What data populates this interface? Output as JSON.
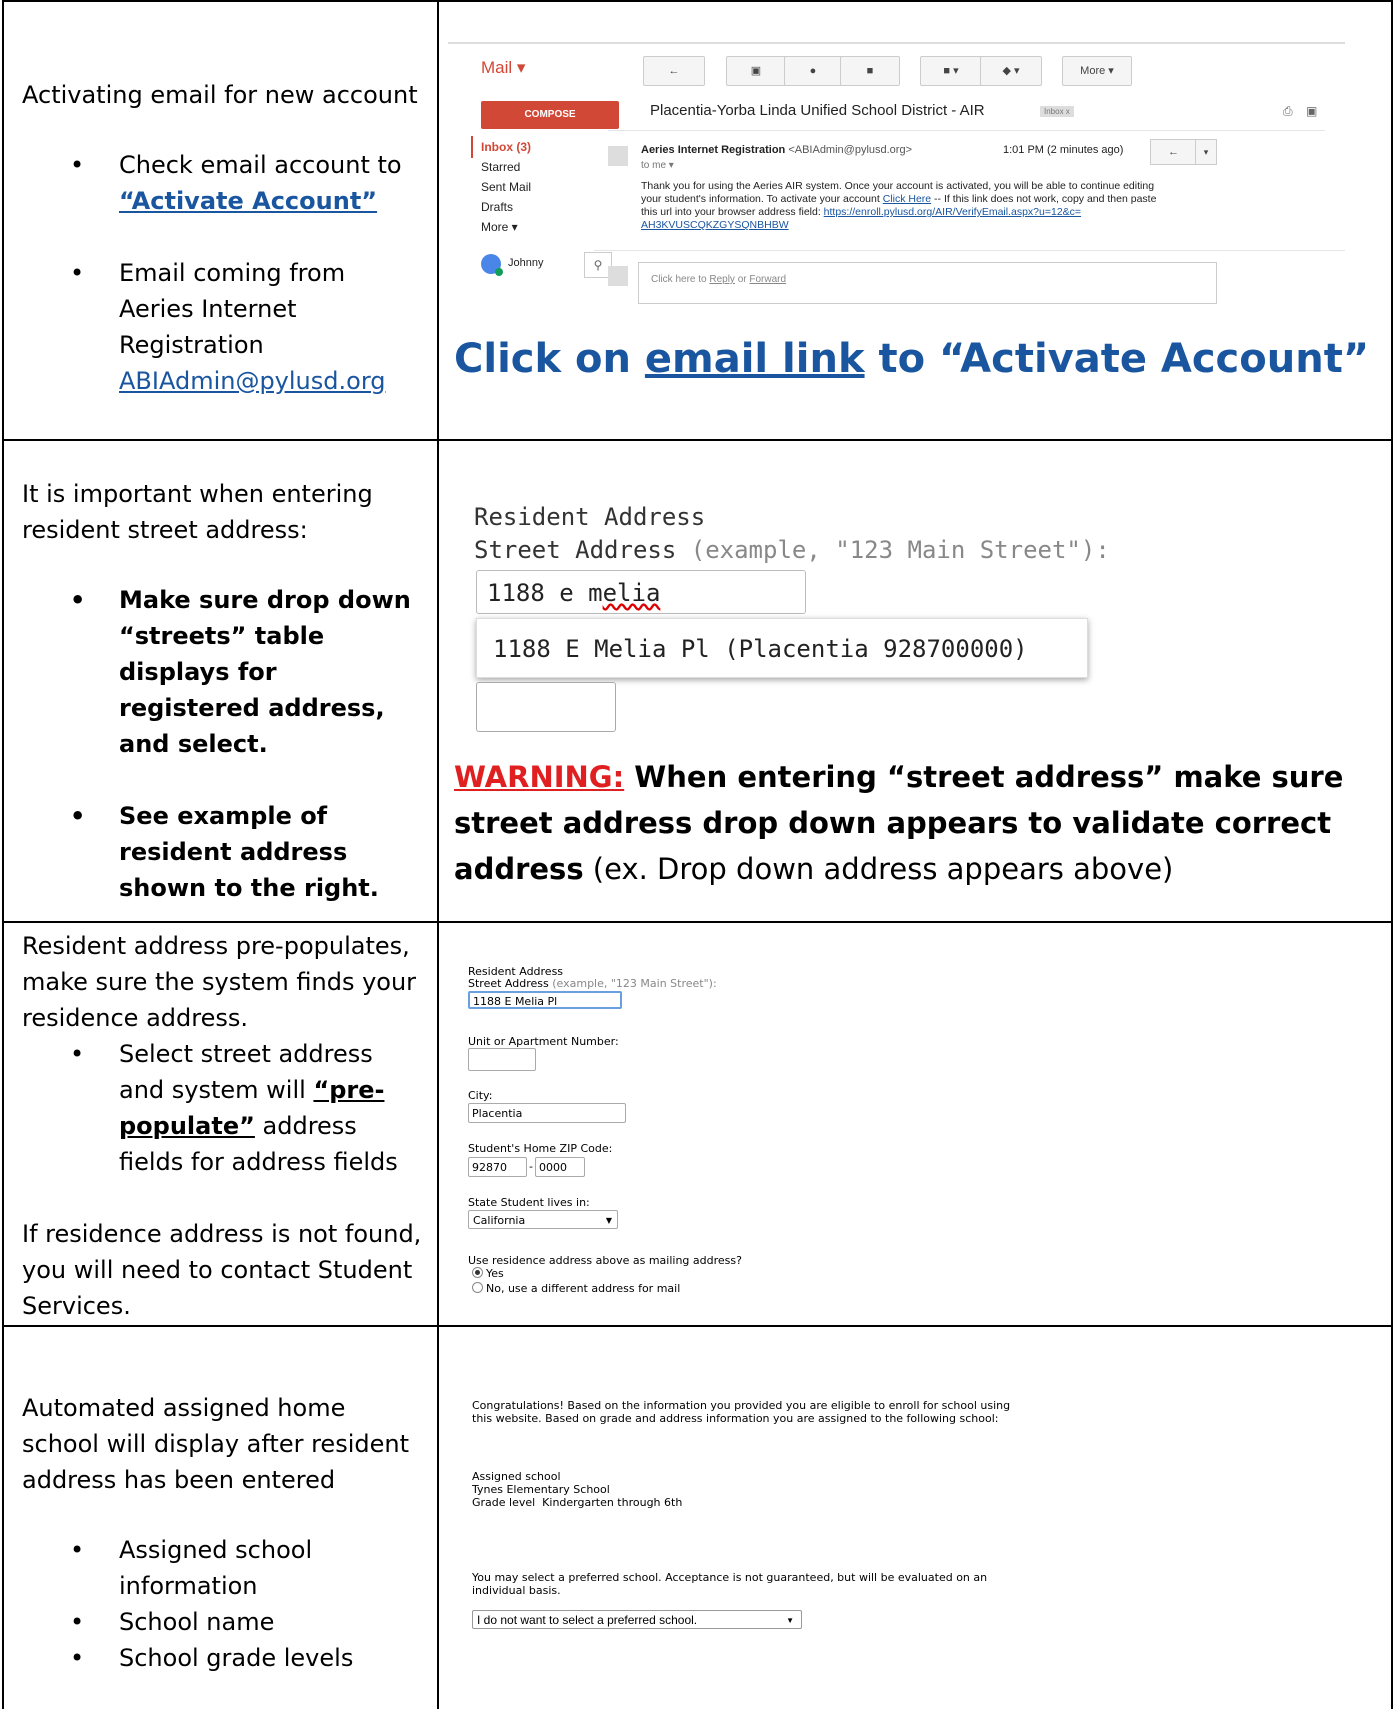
{
  "row1": {
    "left": {
      "heading": "Activating email for new account",
      "bullet1_text": "Check email account to",
      "bullet1_link": "“Activate Account”",
      "bullet2_text": "Email coming from Aeries Internet Registration",
      "bullet2_email": "ABIAdmin@pylusd.org"
    },
    "gmail": {
      "mail_label": "Mail ▾",
      "compose_label": "COMPOSE",
      "toolbar": [
        "←",
        "▣",
        "●",
        "■",
        "■ ▾",
        "◆ ▾",
        "More ▾"
      ],
      "subject": "Placentia-Yorba Linda Unified School District - AIR",
      "inbox_tag": "Inbox  x",
      "nav": [
        "Inbox (3)",
        "Starred",
        "Sent Mail",
        "Drafts",
        "More ▾"
      ],
      "user": "Johnny",
      "sender_name": "Aeries Internet Registration",
      "sender_email": "<ABIAdmin@pylusd.org>",
      "to_me": "to me ▾",
      "time": "1:01 PM (2 minutes ago)",
      "body_1": "Thank you for using the Aeries AIR system. Once your account is activated, you will be able to continue editing",
      "body_2a": "your student's information. To activate your account ",
      "body_2_link": "Click Here",
      "body_2b": " -- If this link does not work, copy and then paste",
      "body_3a": "this url into your browser address field: ",
      "body_3_link": "https://enroll.pylusd.org/AIR/VerifyEmail.aspx?u=12&c=",
      "body_4_link": "AH3KVUSCQKZGYSQNBHBW",
      "reply_text_a": "Click here to ",
      "reply_link": "Reply",
      "reply_text_b": " or ",
      "forward_link": "Forward"
    },
    "caption_a": "Click on ",
    "caption_link": "email link",
    "caption_b": "  to “Activate Account”"
  },
  "row2": {
    "left": {
      "intro": "It is important when entering resident street address:",
      "bullet1": "Make sure drop down “streets” table displays for registered address, and select.",
      "bullet2": "See example of resident address shown to the right."
    },
    "shot": {
      "title": "Resident Address",
      "label": "Street Address",
      "example": "(example, \"123 Main Street\"):",
      "input_prefix": "1188 e m",
      "input_suffix": "elia",
      "suggestion": "1188 E Melia Pl (Placentia 928700000)"
    },
    "warning_label": "WARNING:",
    "warning_bold": " When entering “street address” make sure street address drop down appears to validate correct address",
    "warning_normal": " (ex. Drop down address appears above)"
  },
  "row3": {
    "left": {
      "intro": "Resident address pre-populates, make sure the system finds your residence address.",
      "bullet_a": "Select street address and system will ",
      "bullet_bold": "“pre-populate”",
      "bullet_b": " address fields for address fields",
      "outro": "If residence address is not found, you will need to contact Student Services."
    },
    "form": {
      "title": "Resident Address",
      "street_label": "Street Address",
      "street_example": "(example, \"123 Main Street\"):",
      "street_value": "1188 E Melia Pl",
      "unit_label": "Unit or Apartment Number:",
      "city_label": "City:",
      "city_value": "Placentia",
      "zip_label": "Student's Home ZIP Code:",
      "zip_value": "92870",
      "zip_dash": "-",
      "zip_ext": "0000",
      "state_label": "State Student lives in:",
      "state_value": "California",
      "mailing_question": "Use residence address above as mailing address?",
      "opt_yes": "Yes",
      "opt_no": "No, use a different address for mail"
    }
  },
  "row4": {
    "left": {
      "intro": "Automated assigned home school will display after resident address has been entered",
      "bullets": [
        "Assigned school information",
        "School name",
        "School grade levels"
      ]
    },
    "shot": {
      "congrats_1": "Congratulations! Based on the information you provided you are eligible to enroll for school using",
      "congrats_2": "this website. Based on grade and address information you are assigned to the following school:",
      "assigned_label": "Assigned school",
      "school_name": "Tynes Elementary School",
      "grade_level": "Grade level  Kindergarten through 6th",
      "preferred_1": "You may select a preferred school. Acceptance is not guaranteed, but will be evaluated on an",
      "preferred_2": "individual basis.",
      "select_value": "I do not want to select a preferred school."
    }
  }
}
